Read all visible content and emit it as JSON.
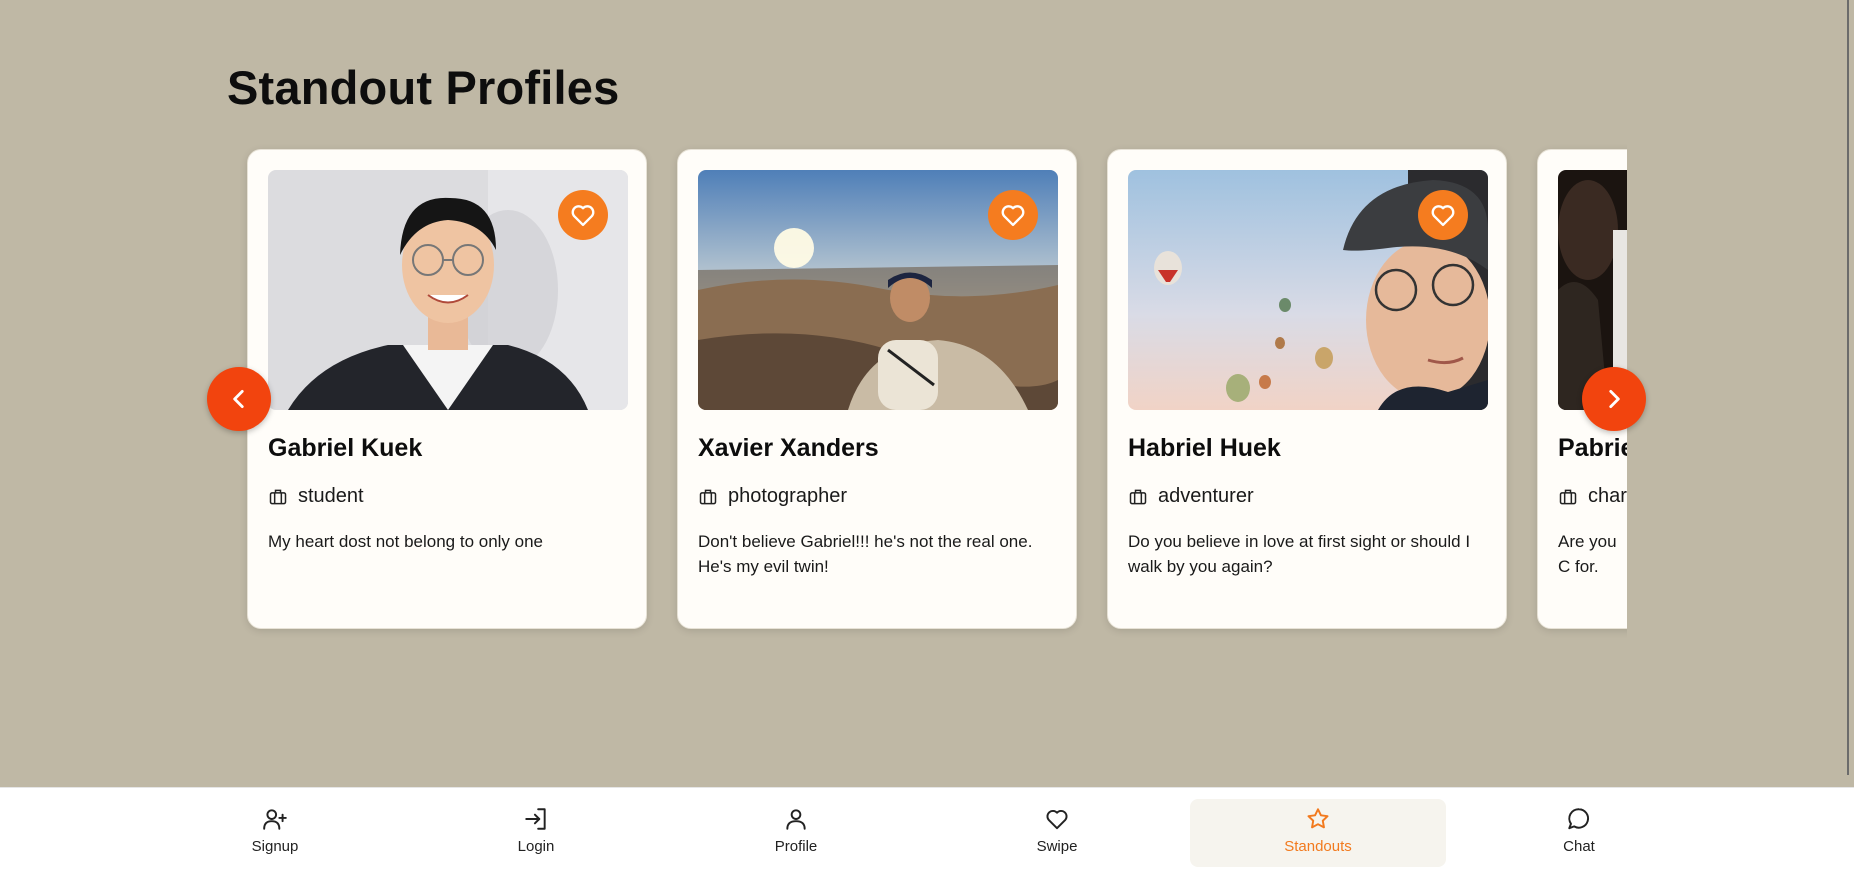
{
  "page": {
    "title": "Standout Profiles"
  },
  "profiles": [
    {
      "name": "Gabriel Kuek",
      "job": "student",
      "bio": "My heart dost not belong to only one"
    },
    {
      "name": "Xavier Xanders",
      "job": "photographer",
      "bio": "Don't believe Gabriel!!! he's not the real one. He's my evil twin!"
    },
    {
      "name": "Habriel Huek",
      "job": "adventurer",
      "bio": "Do you believe in love at first sight or should I walk by you again?"
    },
    {
      "name": "Pabrie",
      "job": "char",
      "bio": "Are you C for."
    }
  ],
  "nav": {
    "items": [
      {
        "label": "Signup",
        "icon": "user-plus-icon"
      },
      {
        "label": "Login",
        "icon": "login-icon"
      },
      {
        "label": "Profile",
        "icon": "user-icon"
      },
      {
        "label": "Swipe",
        "icon": "heart-icon"
      },
      {
        "label": "Standouts",
        "icon": "star-icon"
      },
      {
        "label": "Chat",
        "icon": "chat-bubble-icon"
      }
    ],
    "active": "Standouts"
  },
  "colors": {
    "background": "#bfb8a5",
    "accent": "#f57c1f",
    "arrow": "#f2440e",
    "active_nav_text": "#f27a1e"
  }
}
